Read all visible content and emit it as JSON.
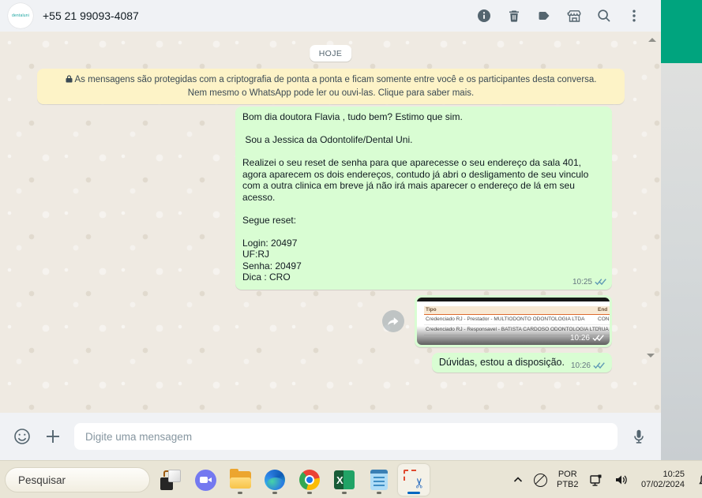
{
  "chat_header": {
    "phone_number": "+55 21 99093-4087",
    "avatar_alt": "contact-avatar",
    "icons": [
      "info-icon",
      "delete-icon",
      "label-icon",
      "storefront-icon",
      "search-icon",
      "kebab-menu-icon"
    ]
  },
  "chat": {
    "date_chip": "HOJE",
    "encryption_notice": "As mensagens são protegidas com a criptografia de ponta a ponta e ficam somente entre você e os participantes desta conversa. Nem mesmo o WhatsApp pode ler ou ouvi-las. Clique para saber mais.",
    "message1": {
      "time": "10:25",
      "lines": [
        "Bom dia doutora Flavia , tudo bem? Estimo que sim.",
        "",
        " Sou a Jessica da Odontolife/Dental Uni.",
        "",
        "Realizei o seu reset de senha para que aparecesse o seu endereço da sala 401, agora aparecem os dois endereços, contudo já abri o desligamento de seu vinculo com a outra clinica em breve já não irá mais aparecer o endereço de lá em seu acesso.",
        "",
        "Segue reset:",
        "",
        "Login: 20497",
        "UF:RJ",
        "Senha: 20497",
        "Dica : CRO"
      ]
    },
    "image_message": {
      "time": "10:26",
      "table": {
        "col1_header": "Tipo",
        "col2_header": "End",
        "rows": [
          {
            "col1": "Credenciado RJ - Prestador - MULTIODONTO ODONTOLOGIA LTDA",
            "col2": "CON"
          },
          {
            "col1": "Credenciado RJ - Responsavel - BATISTA CARDOSO ODONTOLOGIA LTDA",
            "col2": "RUA"
          }
        ]
      }
    },
    "message2": {
      "text": "Dúvidas, estou a disposição.",
      "time": "10:26"
    }
  },
  "composer": {
    "placeholder": "Digite uma mensagem",
    "icons": [
      "emoji-icon",
      "plus-icon",
      "mic-icon"
    ]
  },
  "taskbar": {
    "search_placeholder": "Pesquisar",
    "apps": [
      "task-view-icon",
      "zoom-app-icon",
      "file-explorer-icon",
      "edge-icon",
      "chrome-icon",
      "excel-icon",
      "notepad-icon",
      "snipping-tool-icon"
    ],
    "excel_letter": "X",
    "tray": {
      "language_top": "POR",
      "language_bottom": "PTB2",
      "time": "10:25",
      "date": "07/02/2024",
      "icons": [
        "chevron-up-icon",
        "mute-icon",
        "network-icon",
        "volume-icon",
        "bell-icon"
      ]
    }
  },
  "colors": {
    "accent_teal": "#00a47e",
    "bubble_out": "#d9fdd3",
    "banner_yellow": "#fdf3c7",
    "header_bg": "#f0f2f5",
    "check_mark": "#5f9ab5"
  }
}
